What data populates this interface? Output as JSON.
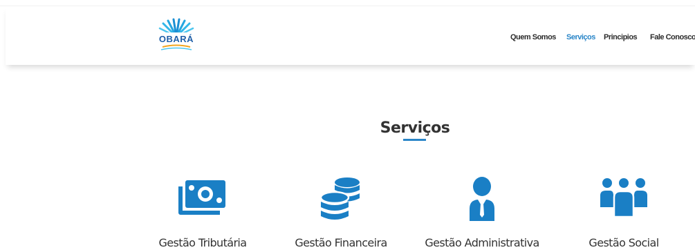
{
  "header": {
    "logo_text": "OBARÁ",
    "nav": [
      {
        "label": "Quem Somos",
        "active": false
      },
      {
        "label": "Serviços",
        "active": true
      },
      {
        "label": "Principios",
        "active": false
      },
      {
        "label": "Fale Conosco",
        "active": false
      }
    ]
  },
  "section": {
    "title": "Serviços"
  },
  "services": [
    {
      "label": "Gestão Tributária",
      "icon": "money-bills-icon"
    },
    {
      "label": "Gestão Financeira",
      "icon": "coin-stack-icon"
    },
    {
      "label": "Gestão Administrativa",
      "icon": "businessman-icon"
    },
    {
      "label": "Gestão Social",
      "icon": "people-group-icon"
    }
  ],
  "colors": {
    "accent": "#2a86c8",
    "icon_blue": "#1a7fc5",
    "text": "#333333"
  }
}
